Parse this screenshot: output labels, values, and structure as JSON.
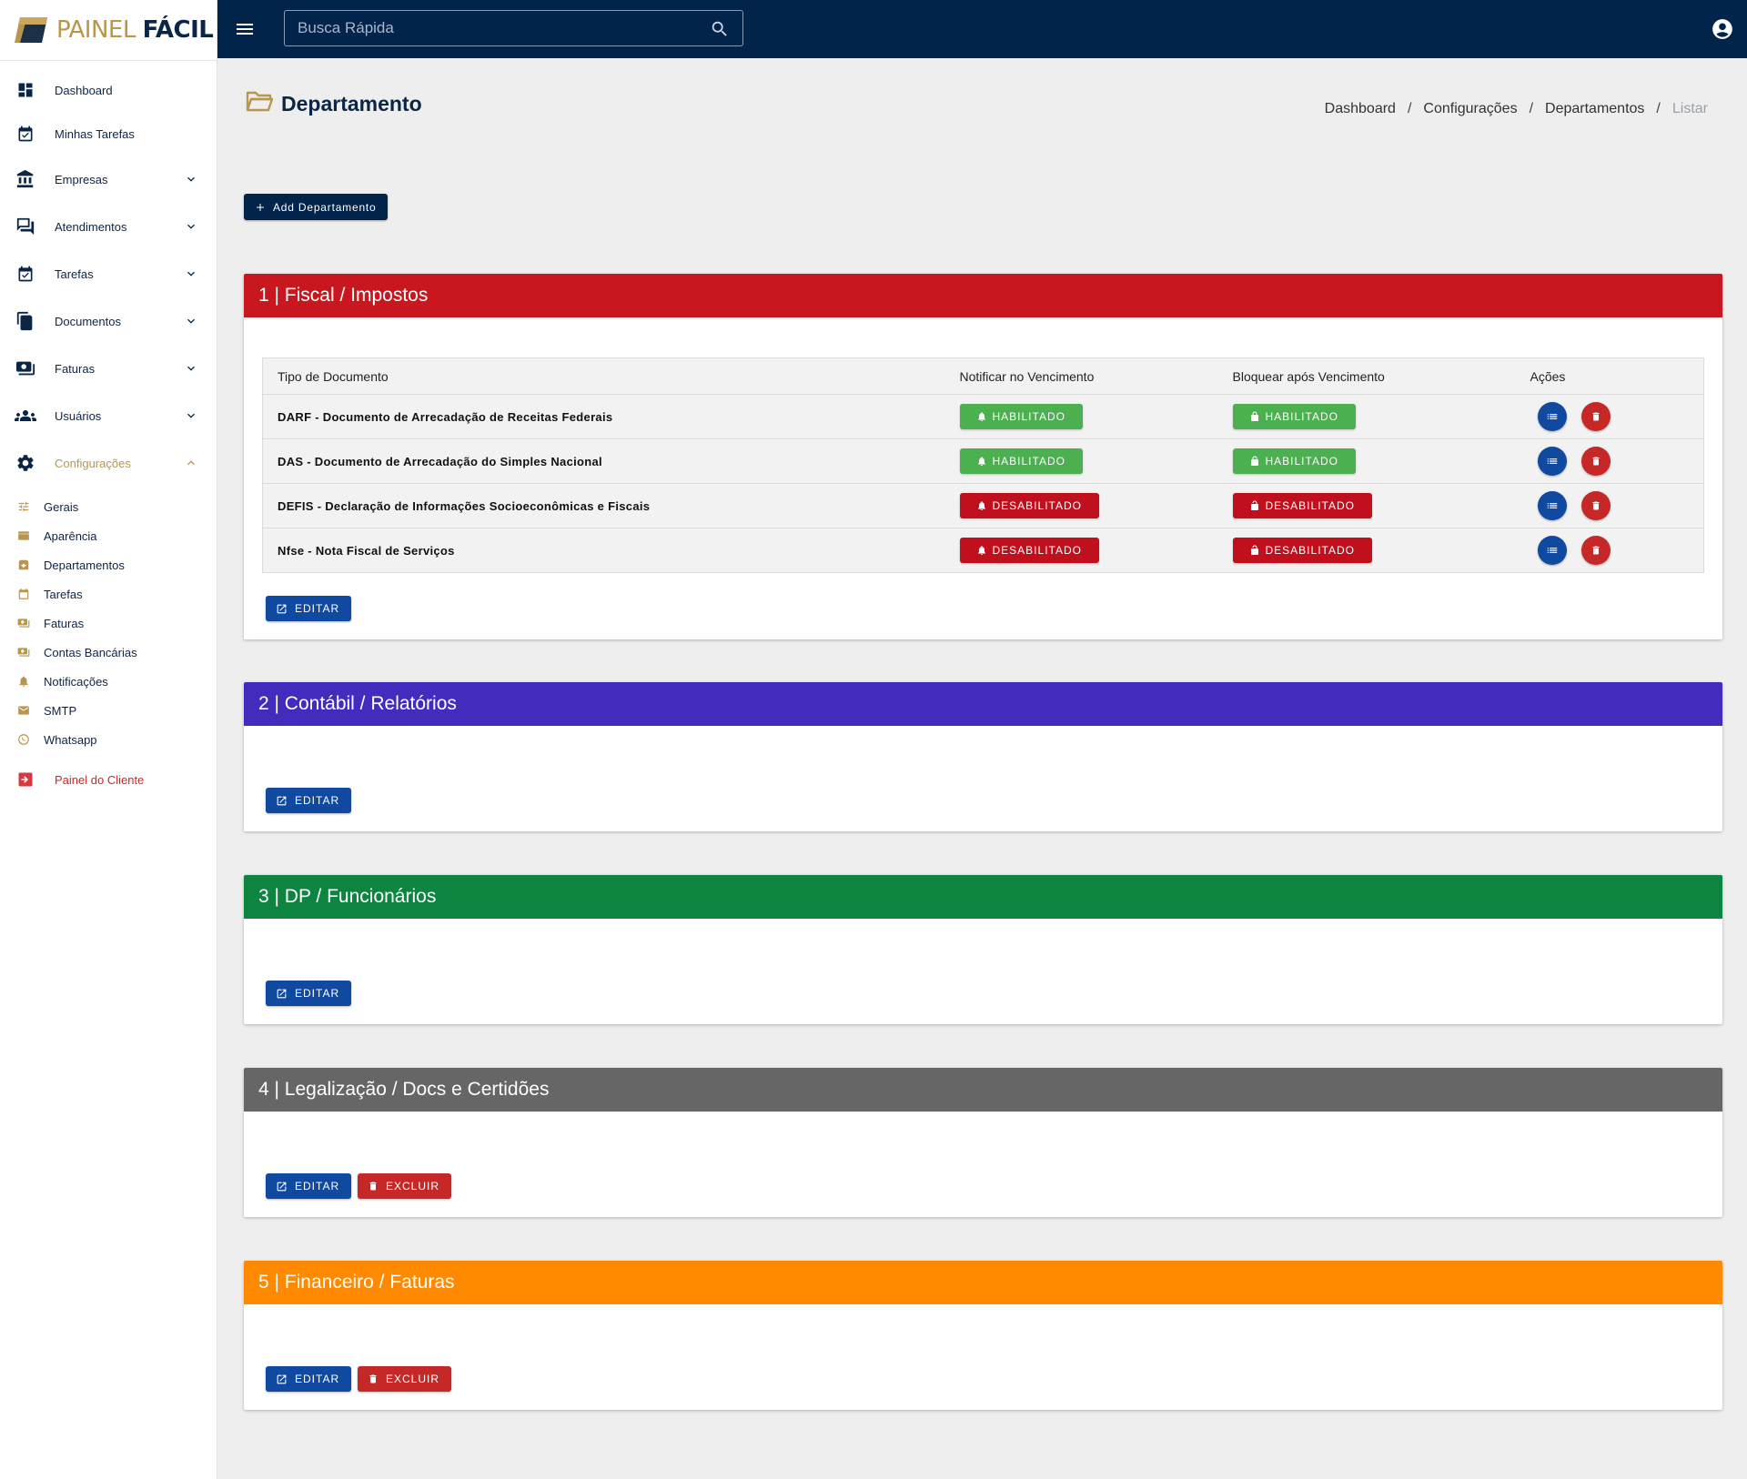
{
  "app": {
    "logo_part1": "PAINEL ",
    "logo_part2": "FÁCIL"
  },
  "search": {
    "placeholder": "Busca Rápida"
  },
  "sidebar": {
    "items": [
      {
        "label": "Dashboard"
      },
      {
        "label": "Minhas Tarefas"
      },
      {
        "label": "Empresas"
      },
      {
        "label": "Atendimentos"
      },
      {
        "label": "Tarefas"
      },
      {
        "label": "Documentos"
      },
      {
        "label": "Faturas"
      },
      {
        "label": "Usuários"
      },
      {
        "label": "Configurações"
      }
    ],
    "sub_items": [
      {
        "label": "Gerais"
      },
      {
        "label": "Aparência"
      },
      {
        "label": "Departamentos"
      },
      {
        "label": "Tarefas"
      },
      {
        "label": "Faturas"
      },
      {
        "label": "Contas Bancárias"
      },
      {
        "label": "Notificações"
      },
      {
        "label": "SMTP"
      },
      {
        "label": "Whatsapp"
      }
    ],
    "client_panel": "Painel do Cliente"
  },
  "page": {
    "title": "Departamento",
    "breadcrumb": [
      "Dashboard",
      "Configurações",
      "Departamentos",
      "Listar"
    ],
    "add_button": "Add Departamento"
  },
  "colors": {
    "brand_gold": "#b8964e",
    "brand_navy": "#02234a"
  },
  "departments": [
    {
      "title": "1 | Fiscal / Impostos",
      "color": "#c8171e"
    },
    {
      "title": "2 | Contábil / Relatórios",
      "color": "#432bbd"
    },
    {
      "title": "3 | DP / Funcionários",
      "color": "#0d8440"
    },
    {
      "title": "4 | Legalização / Docs e Certidões",
      "color": "#666666"
    },
    {
      "title": "5 | Financeiro / Faturas",
      "color": "#ff8a00"
    }
  ],
  "table": {
    "headers": [
      "Tipo de Documento",
      "Notificar no Vencimento",
      "Bloquear após Vencimento",
      "Ações"
    ],
    "rows": [
      {
        "doc": "DARF - Documento de Arrecadação de Receitas Federais",
        "notify": "HABILITADO",
        "block": "HABILITADO"
      },
      {
        "doc": "DAS - Documento de Arrecadação do Simples Nacional",
        "notify": "HABILITADO",
        "block": "HABILITADO"
      },
      {
        "doc": "DEFIS - Declaração de Informações Socioeconômicas e Fiscais",
        "notify": "DESABILITADO",
        "block": "DESABILITADO"
      },
      {
        "doc": "Nfse - Nota Fiscal de Serviços",
        "notify": "DESABILITADO",
        "block": "DESABILITADO"
      }
    ]
  },
  "buttons": {
    "edit": "EDITAR",
    "delete": "EXCLUIR"
  }
}
